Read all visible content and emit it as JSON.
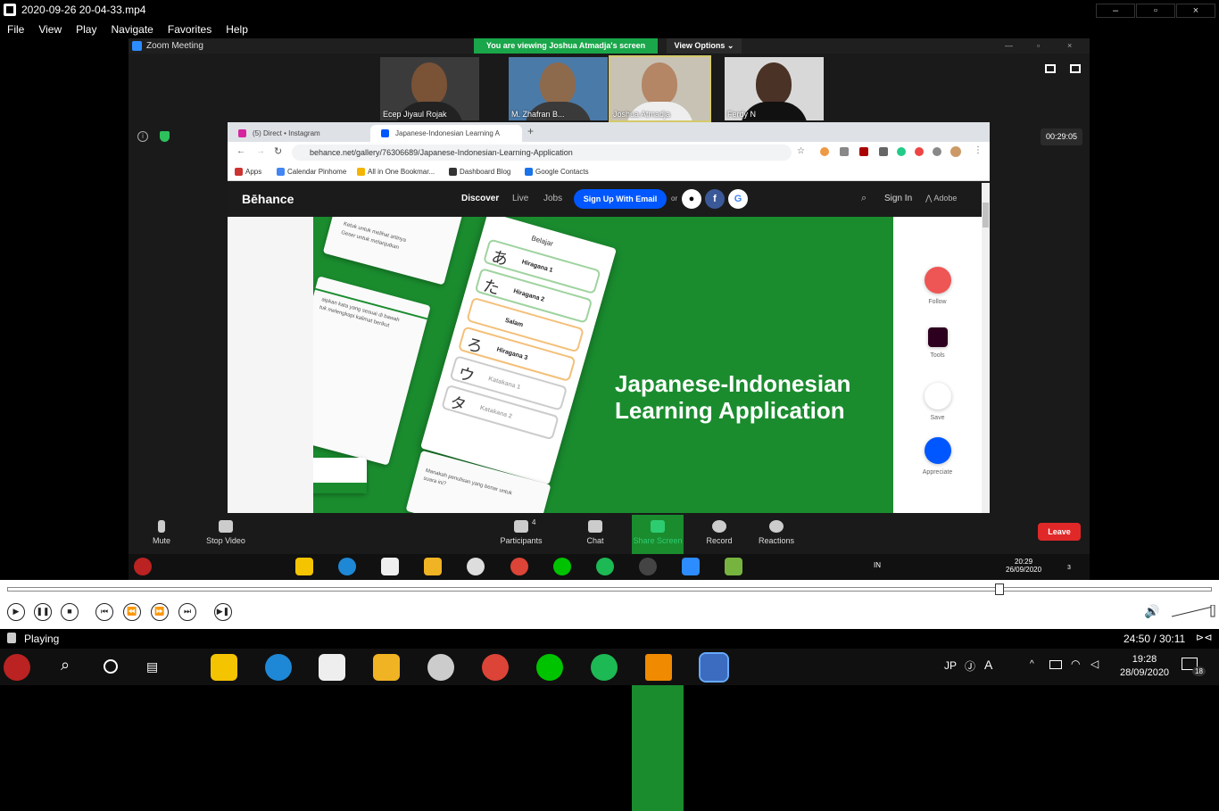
{
  "window": {
    "title": "2020-09-26 20-04-33.mp4",
    "minimize": "–",
    "maximize": "▫",
    "close": "×"
  },
  "menu": [
    "File",
    "View",
    "Play",
    "Navigate",
    "Favorites",
    "Help"
  ],
  "zoom": {
    "title": "Zoom Meeting",
    "banner": "You are viewing Joshua Atmadja's screen",
    "view_options": "View Options ⌄",
    "participants": [
      {
        "name": "Ecep Jiyaul Rojak"
      },
      {
        "name": "M. Zhafran B..."
      },
      {
        "name": "Joshua Atmadja"
      },
      {
        "name": "Ferdy N"
      }
    ],
    "timer": "00:29:05",
    "toolbar": {
      "mute": "Mute",
      "stop_video": "Stop Video",
      "participants": "Participants",
      "participants_count": "4",
      "chat": "Chat",
      "share_screen": "Share Screen",
      "record": "Record",
      "reactions": "Reactions",
      "leave": "Leave"
    },
    "inner_tray": {
      "lang": "IN",
      "time": "20:29",
      "date": "26/09/2020",
      "notif": "3"
    }
  },
  "browser": {
    "tabs": [
      {
        "label": "(5) Direct • Instagram",
        "color": "#d6249f"
      },
      {
        "label": "Japanese-Indonesian Learning A",
        "color": "#0057ff"
      }
    ],
    "url": "behance.net/gallery/76306689/Japanese-Indonesian-Learning-Application",
    "bookmarks": [
      {
        "label": "Apps",
        "color": "#c33"
      },
      {
        "label": "Calendar Pinhome",
        "color": "#4285f4"
      },
      {
        "label": "All in One Bookmar...",
        "color": "#f4b400"
      },
      {
        "label": "Dashboard Blog",
        "color": "#333"
      },
      {
        "label": "Google Contacts",
        "color": "#1a73e8"
      }
    ]
  },
  "behance": {
    "logo": "Bēhance",
    "nav": [
      "Discover",
      "Live",
      "Jobs"
    ],
    "signup": "Sign Up With Email",
    "or": "or",
    "signin": "Sign In",
    "adobe": "Adobe",
    "headline_1": "Japanese-Indonesian",
    "headline_2": "Learning Application",
    "phone": {
      "title": "Belajar",
      "lessons": [
        {
          "kana": "あ",
          "label": "Hiragana 1"
        },
        {
          "kana": "た",
          "label": "Hiragana 2"
        },
        {
          "kana": "",
          "label": "Salam"
        },
        {
          "kana": "ろ",
          "label": "Hiragana 3"
        },
        {
          "kana": "ウ",
          "label": "Katakana 1"
        },
        {
          "kana": "タ",
          "label": "Katakana 2"
        }
      ]
    },
    "card_top_text_1": "Ketuk untuk melihat artinya",
    "card_top_text_2": "Geser untuk melanjutkan",
    "card_left_text_1": "aipkan kata yang sesuai di bawah",
    "card_left_text_2": "tuk melengkapi kalimat berikut",
    "card_bottom_text_1": "Manakah penulisan yang benar untuk",
    "card_bottom_text_2": "suara ini?",
    "rail": [
      "Follow",
      "Tools",
      "Save",
      "Appreciate"
    ]
  },
  "player": {
    "status": "Playing",
    "time": "24:50 / 30:11",
    "progress_fraction": 0.823
  },
  "taskbar": {
    "lang": "JP",
    "ime": "A",
    "time": "19:28",
    "date": "28/09/2020",
    "notif": "18"
  }
}
